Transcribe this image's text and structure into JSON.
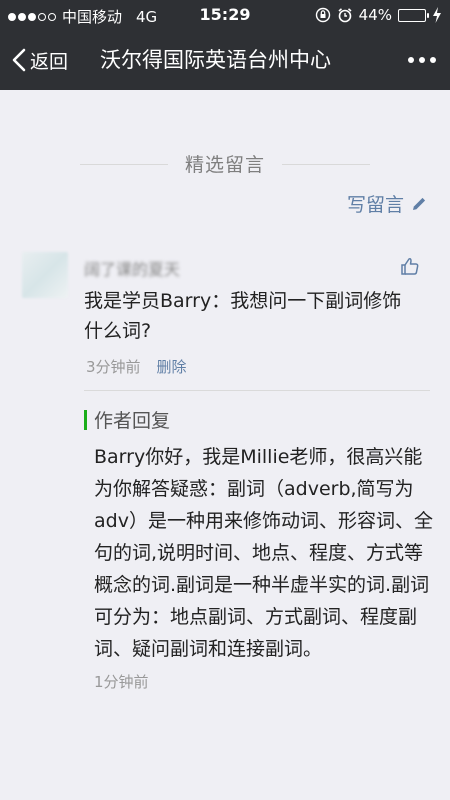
{
  "status_bar": {
    "carrier": "中国移动",
    "network": "4G",
    "time": "15:29",
    "battery_percent": "44%",
    "signal_bars_filled": 3,
    "battery_level": 0.44
  },
  "nav": {
    "back_label": "返回",
    "title": "沃尔得国际英语台州中心"
  },
  "section": {
    "title": "精选留言",
    "write_label": "写留言"
  },
  "comment": {
    "nickname": "阔了课的夏天",
    "text": "我是学员Barry：我想问一下副词修饰什么词?",
    "time": "3分钟前",
    "delete_label": "删除",
    "reply": {
      "label": "作者回复",
      "text": "Barry你好，我是Millie老师，很高兴能为你解答疑惑：副词（adverb,简写为adv）是一种用来修饰动词、形容词、全句的词,说明时间、地点、程度、方式等概念的词.副词是一种半虚半实的词.副词可分为：地点副词、方式副词、程度副词、疑问副词和连接副词。",
      "time": "1分钟前"
    }
  },
  "colors": {
    "nav_background": "#2e3034",
    "link": "#607fa6",
    "reply_accent": "#1aad19",
    "page_background": "#efeff4"
  }
}
